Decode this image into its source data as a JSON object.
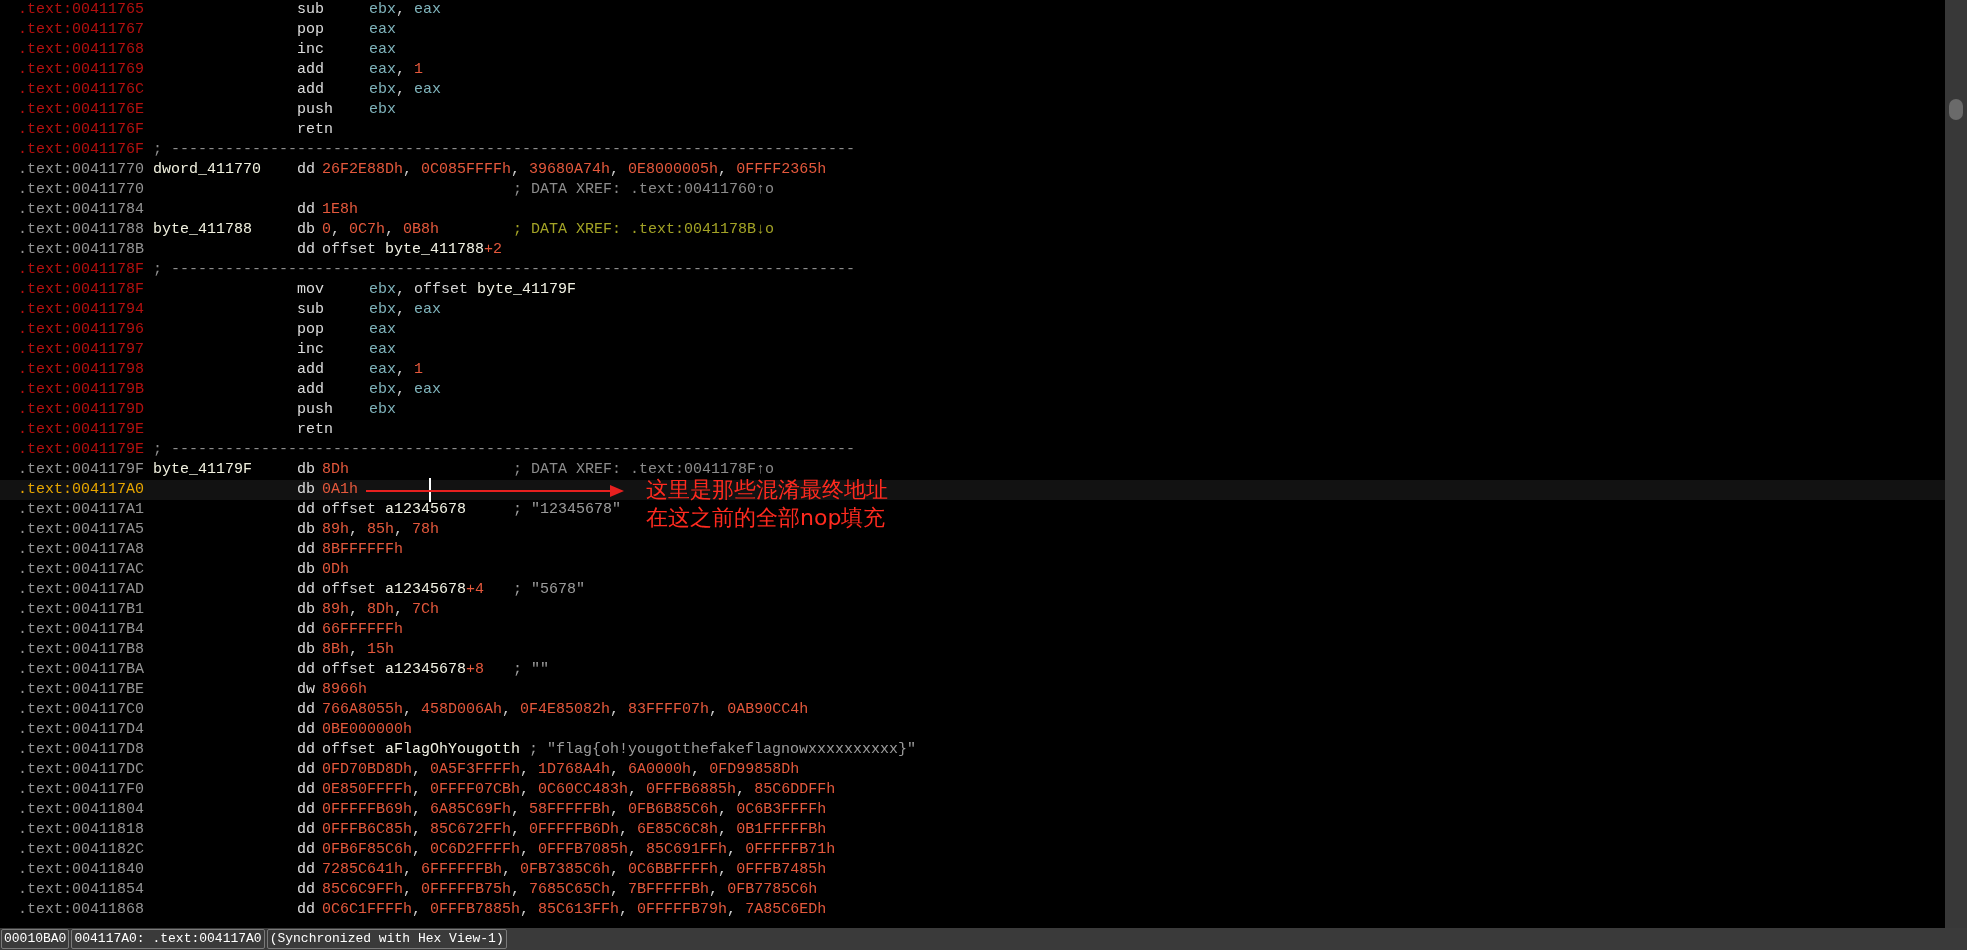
{
  "listing": {
    "rows": [
      {
        "address": ".text:00411765",
        "kind": "code",
        "selected": false,
        "mnemonic": "sub",
        "operands": [
          {
            "text": "ebx",
            "kind": "reg"
          },
          {
            "text": ", ",
            "kind": "punct"
          },
          {
            "text": "eax",
            "kind": "reg"
          }
        ]
      },
      {
        "address": ".text:00411767",
        "kind": "code",
        "selected": false,
        "mnemonic": "pop",
        "operands": [
          {
            "text": "eax",
            "kind": "reg"
          }
        ]
      },
      {
        "address": ".text:00411768",
        "kind": "code",
        "selected": false,
        "mnemonic": "inc",
        "operands": [
          {
            "text": "eax",
            "kind": "reg"
          }
        ]
      },
      {
        "address": ".text:00411769",
        "kind": "code",
        "selected": false,
        "mnemonic": "add",
        "operands": [
          {
            "text": "eax",
            "kind": "reg"
          },
          {
            "text": ", ",
            "kind": "punct"
          },
          {
            "text": "1",
            "kind": "num"
          }
        ]
      },
      {
        "address": ".text:0041176C",
        "kind": "code",
        "selected": false,
        "mnemonic": "add",
        "operands": [
          {
            "text": "ebx",
            "kind": "reg"
          },
          {
            "text": ", ",
            "kind": "punct"
          },
          {
            "text": "eax",
            "kind": "reg"
          }
        ]
      },
      {
        "address": ".text:0041176E",
        "kind": "code",
        "selected": false,
        "mnemonic": "push",
        "operands": [
          {
            "text": "ebx",
            "kind": "reg"
          }
        ]
      },
      {
        "address": ".text:0041176F",
        "kind": "code",
        "selected": false,
        "mnemonic": "retn"
      },
      {
        "address": ".text:0041176F",
        "kind": "code",
        "selected": false,
        "separator": "; ----------------------------------------------------------------------------"
      },
      {
        "address": ".text:00411770",
        "kind": "data",
        "selected": false,
        "label": "dword_411770",
        "mnemonic": "dd",
        "operands": [
          {
            "text": "26F2E88Dh",
            "kind": "num"
          },
          {
            "text": ", ",
            "kind": "punct"
          },
          {
            "text": "0C085FFFFh",
            "kind": "num"
          },
          {
            "text": ", ",
            "kind": "punct"
          },
          {
            "text": "39680A74h",
            "kind": "num"
          },
          {
            "text": ", ",
            "kind": "punct"
          },
          {
            "text": "0E8000005h",
            "kind": "num"
          },
          {
            "text": ", ",
            "kind": "punct"
          },
          {
            "text": "0FFFF2365h",
            "kind": "num"
          }
        ]
      },
      {
        "address": ".text:00411770",
        "kind": "data",
        "selected": false,
        "comment": {
          "text": "; DATA XREF: .text:00411760↑o",
          "kind": "xref"
        }
      },
      {
        "address": ".text:00411784",
        "kind": "data",
        "selected": false,
        "mnemonic": "dd",
        "operands": [
          {
            "text": "1E8h",
            "kind": "num"
          }
        ]
      },
      {
        "address": ".text:00411788",
        "kind": "data",
        "selected": false,
        "label": "byte_411788",
        "mnemonic": "db",
        "operands": [
          {
            "text": "0",
            "kind": "num"
          },
          {
            "text": ", ",
            "kind": "punct"
          },
          {
            "text": "0C7h",
            "kind": "num"
          },
          {
            "text": ", ",
            "kind": "punct"
          },
          {
            "text": "0B8h",
            "kind": "num"
          }
        ],
        "comment": {
          "text": "; DATA XREF: .text:0041178B↓o",
          "kind": "highlight"
        }
      },
      {
        "address": ".text:0041178B",
        "kind": "data",
        "selected": false,
        "mnemonic": "dd",
        "operands": [
          {
            "text": "offset ",
            "kind": "kw"
          },
          {
            "text": "byte_411788",
            "kind": "name"
          },
          {
            "text": "+2",
            "kind": "num"
          }
        ]
      },
      {
        "address": ".text:0041178F",
        "kind": "code",
        "selected": false,
        "separator": "; ----------------------------------------------------------------------------"
      },
      {
        "address": ".text:0041178F",
        "kind": "code",
        "selected": false,
        "mnemonic": "mov",
        "operands": [
          {
            "text": "ebx",
            "kind": "reg"
          },
          {
            "text": ", ",
            "kind": "punct"
          },
          {
            "text": "offset ",
            "kind": "kw"
          },
          {
            "text": "byte_41179F",
            "kind": "name"
          }
        ]
      },
      {
        "address": ".text:00411794",
        "kind": "code",
        "selected": false,
        "mnemonic": "sub",
        "operands": [
          {
            "text": "ebx",
            "kind": "reg"
          },
          {
            "text": ", ",
            "kind": "punct"
          },
          {
            "text": "eax",
            "kind": "reg"
          }
        ]
      },
      {
        "address": ".text:00411796",
        "kind": "code",
        "selected": false,
        "mnemonic": "pop",
        "operands": [
          {
            "text": "eax",
            "kind": "reg"
          }
        ]
      },
      {
        "address": ".text:00411797",
        "kind": "code",
        "selected": false,
        "mnemonic": "inc",
        "operands": [
          {
            "text": "eax",
            "kind": "reg"
          }
        ]
      },
      {
        "address": ".text:00411798",
        "kind": "code",
        "selected": false,
        "mnemonic": "add",
        "operands": [
          {
            "text": "eax",
            "kind": "reg"
          },
          {
            "text": ", ",
            "kind": "punct"
          },
          {
            "text": "1",
            "kind": "num"
          }
        ]
      },
      {
        "address": ".text:0041179B",
        "kind": "code",
        "selected": false,
        "mnemonic": "add",
        "operands": [
          {
            "text": "ebx",
            "kind": "reg"
          },
          {
            "text": ", ",
            "kind": "punct"
          },
          {
            "text": "eax",
            "kind": "reg"
          }
        ]
      },
      {
        "address": ".text:0041179D",
        "kind": "code",
        "selected": false,
        "mnemonic": "push",
        "operands": [
          {
            "text": "ebx",
            "kind": "reg"
          }
        ]
      },
      {
        "address": ".text:0041179E",
        "kind": "code",
        "selected": false,
        "mnemonic": "retn"
      },
      {
        "address": ".text:0041179E",
        "kind": "code",
        "selected": false,
        "separator": "; ----------------------------------------------------------------------------"
      },
      {
        "address": ".text:0041179F",
        "kind": "data",
        "selected": false,
        "label": "byte_41179F",
        "mnemonic": "db",
        "operands": [
          {
            "text": "8Dh",
            "kind": "num"
          }
        ],
        "comment": {
          "text": "; DATA XREF: .text:0041178F↑o",
          "kind": "xref"
        }
      },
      {
        "address": ".text:004117A0",
        "kind": "data",
        "selected": true,
        "mnemonic": "db",
        "operands": [
          {
            "text": "0A1h",
            "kind": "num"
          }
        ]
      },
      {
        "address": ".text:004117A1",
        "kind": "data",
        "selected": false,
        "mnemonic": "dd",
        "operands": [
          {
            "text": "offset ",
            "kind": "kw"
          },
          {
            "text": "a12345678",
            "kind": "name"
          }
        ],
        "comment": {
          "text": "; \"12345678\"",
          "kind": "string"
        }
      },
      {
        "address": ".text:004117A5",
        "kind": "data",
        "selected": false,
        "mnemonic": "db",
        "operands": [
          {
            "text": "89h",
            "kind": "num"
          },
          {
            "text": ", ",
            "kind": "punct"
          },
          {
            "text": "85h",
            "kind": "num"
          },
          {
            "text": ", ",
            "kind": "punct"
          },
          {
            "text": "78h",
            "kind": "num"
          }
        ]
      },
      {
        "address": ".text:004117A8",
        "kind": "data",
        "selected": false,
        "mnemonic": "dd",
        "operands": [
          {
            "text": "8BFFFFFFh",
            "kind": "num"
          }
        ]
      },
      {
        "address": ".text:004117AC",
        "kind": "data",
        "selected": false,
        "mnemonic": "db",
        "operands": [
          {
            "text": "0Dh",
            "kind": "num"
          }
        ]
      },
      {
        "address": ".text:004117AD",
        "kind": "data",
        "selected": false,
        "mnemonic": "dd",
        "operands": [
          {
            "text": "offset ",
            "kind": "kw"
          },
          {
            "text": "a12345678",
            "kind": "name"
          },
          {
            "text": "+4",
            "kind": "num"
          }
        ],
        "comment": {
          "text": "; \"5678\"",
          "kind": "string"
        }
      },
      {
        "address": ".text:004117B1",
        "kind": "data",
        "selected": false,
        "mnemonic": "db",
        "operands": [
          {
            "text": "89h",
            "kind": "num"
          },
          {
            "text": ", ",
            "kind": "punct"
          },
          {
            "text": "8Dh",
            "kind": "num"
          },
          {
            "text": ", ",
            "kind": "punct"
          },
          {
            "text": "7Ch",
            "kind": "num"
          }
        ]
      },
      {
        "address": ".text:004117B4",
        "kind": "data",
        "selected": false,
        "mnemonic": "dd",
        "operands": [
          {
            "text": "66FFFFFFh",
            "kind": "num"
          }
        ]
      },
      {
        "address": ".text:004117B8",
        "kind": "data",
        "selected": false,
        "mnemonic": "db",
        "operands": [
          {
            "text": "8Bh",
            "kind": "num"
          },
          {
            "text": ", ",
            "kind": "punct"
          },
          {
            "text": "15h",
            "kind": "num"
          }
        ]
      },
      {
        "address": ".text:004117BA",
        "kind": "data",
        "selected": false,
        "mnemonic": "dd",
        "operands": [
          {
            "text": "offset ",
            "kind": "kw"
          },
          {
            "text": "a12345678",
            "kind": "name"
          },
          {
            "text": "+8",
            "kind": "num"
          }
        ],
        "comment": {
          "text": "; \"\"",
          "kind": "string"
        }
      },
      {
        "address": ".text:004117BE",
        "kind": "data",
        "selected": false,
        "mnemonic": "dw",
        "operands": [
          {
            "text": "8966h",
            "kind": "num"
          }
        ]
      },
      {
        "address": ".text:004117C0",
        "kind": "data",
        "selected": false,
        "mnemonic": "dd",
        "operands": [
          {
            "text": "766A8055h",
            "kind": "num"
          },
          {
            "text": ", ",
            "kind": "punct"
          },
          {
            "text": "458D006Ah",
            "kind": "num"
          },
          {
            "text": ", ",
            "kind": "punct"
          },
          {
            "text": "0F4E85082h",
            "kind": "num"
          },
          {
            "text": ", ",
            "kind": "punct"
          },
          {
            "text": "83FFFF07h",
            "kind": "num"
          },
          {
            "text": ", ",
            "kind": "punct"
          },
          {
            "text": "0AB90CC4h",
            "kind": "num"
          }
        ]
      },
      {
        "address": ".text:004117D4",
        "kind": "data",
        "selected": false,
        "mnemonic": "dd",
        "operands": [
          {
            "text": "0BE000000h",
            "kind": "num"
          }
        ]
      },
      {
        "address": ".text:004117D8",
        "kind": "data",
        "selected": false,
        "mnemonic": "dd",
        "operands": [
          {
            "text": "offset ",
            "kind": "kw"
          },
          {
            "text": "aFlagOhYougotth",
            "kind": "name"
          }
        ],
        "comment": {
          "text": "; \"flag{oh!yougotthefakeflagnowxxxxxxxxxx}\"",
          "kind": "string"
        }
      },
      {
        "address": ".text:004117DC",
        "kind": "data",
        "selected": false,
        "mnemonic": "dd",
        "operands": [
          {
            "text": "0FD70BD8Dh",
            "kind": "num"
          },
          {
            "text": ", ",
            "kind": "punct"
          },
          {
            "text": "0A5F3FFFFh",
            "kind": "num"
          },
          {
            "text": ", ",
            "kind": "punct"
          },
          {
            "text": "1D768A4h",
            "kind": "num"
          },
          {
            "text": ", ",
            "kind": "punct"
          },
          {
            "text": "6A0000h",
            "kind": "num"
          },
          {
            "text": ", ",
            "kind": "punct"
          },
          {
            "text": "0FD99858Dh",
            "kind": "num"
          }
        ]
      },
      {
        "address": ".text:004117F0",
        "kind": "data",
        "selected": false,
        "mnemonic": "dd",
        "operands": [
          {
            "text": "0E850FFFFh",
            "kind": "num"
          },
          {
            "text": ", ",
            "kind": "punct"
          },
          {
            "text": "0FFFF07CBh",
            "kind": "num"
          },
          {
            "text": ", ",
            "kind": "punct"
          },
          {
            "text": "0C60CC483h",
            "kind": "num"
          },
          {
            "text": ", ",
            "kind": "punct"
          },
          {
            "text": "0FFFB6885h",
            "kind": "num"
          },
          {
            "text": ", ",
            "kind": "punct"
          },
          {
            "text": "85C6DDFFh",
            "kind": "num"
          }
        ]
      },
      {
        "address": ".text:00411804",
        "kind": "data",
        "selected": false,
        "mnemonic": "dd",
        "operands": [
          {
            "text": "0FFFFFB69h",
            "kind": "num"
          },
          {
            "text": ", ",
            "kind": "punct"
          },
          {
            "text": "6A85C69Fh",
            "kind": "num"
          },
          {
            "text": ", ",
            "kind": "punct"
          },
          {
            "text": "58FFFFFBh",
            "kind": "num"
          },
          {
            "text": ", ",
            "kind": "punct"
          },
          {
            "text": "0FB6B85C6h",
            "kind": "num"
          },
          {
            "text": ", ",
            "kind": "punct"
          },
          {
            "text": "0C6B3FFFFh",
            "kind": "num"
          }
        ]
      },
      {
        "address": ".text:00411818",
        "kind": "data",
        "selected": false,
        "mnemonic": "dd",
        "operands": [
          {
            "text": "0FFFB6C85h",
            "kind": "num"
          },
          {
            "text": ", ",
            "kind": "punct"
          },
          {
            "text": "85C672FFh",
            "kind": "num"
          },
          {
            "text": ", ",
            "kind": "punct"
          },
          {
            "text": "0FFFFFB6Dh",
            "kind": "num"
          },
          {
            "text": ", ",
            "kind": "punct"
          },
          {
            "text": "6E85C6C8h",
            "kind": "num"
          },
          {
            "text": ", ",
            "kind": "punct"
          },
          {
            "text": "0B1FFFFFBh",
            "kind": "num"
          }
        ]
      },
      {
        "address": ".text:0041182C",
        "kind": "data",
        "selected": false,
        "mnemonic": "dd",
        "operands": [
          {
            "text": "0FB6F85C6h",
            "kind": "num"
          },
          {
            "text": ", ",
            "kind": "punct"
          },
          {
            "text": "0C6D2FFFFh",
            "kind": "num"
          },
          {
            "text": ", ",
            "kind": "punct"
          },
          {
            "text": "0FFFB7085h",
            "kind": "num"
          },
          {
            "text": ", ",
            "kind": "punct"
          },
          {
            "text": "85C691FFh",
            "kind": "num"
          },
          {
            "text": ", ",
            "kind": "punct"
          },
          {
            "text": "0FFFFFB71h",
            "kind": "num"
          }
        ]
      },
      {
        "address": ".text:00411840",
        "kind": "data",
        "selected": false,
        "mnemonic": "dd",
        "operands": [
          {
            "text": "7285C641h",
            "kind": "num"
          },
          {
            "text": ", ",
            "kind": "punct"
          },
          {
            "text": "6FFFFFFBh",
            "kind": "num"
          },
          {
            "text": ", ",
            "kind": "punct"
          },
          {
            "text": "0FB7385C6h",
            "kind": "num"
          },
          {
            "text": ", ",
            "kind": "punct"
          },
          {
            "text": "0C6BBFFFFh",
            "kind": "num"
          },
          {
            "text": ", ",
            "kind": "punct"
          },
          {
            "text": "0FFFB7485h",
            "kind": "num"
          }
        ]
      },
      {
        "address": ".text:00411854",
        "kind": "data",
        "selected": false,
        "mnemonic": "dd",
        "operands": [
          {
            "text": "85C6C9FFh",
            "kind": "num"
          },
          {
            "text": ", ",
            "kind": "punct"
          },
          {
            "text": "0FFFFFB75h",
            "kind": "num"
          },
          {
            "text": ", ",
            "kind": "punct"
          },
          {
            "text": "7685C65Ch",
            "kind": "num"
          },
          {
            "text": ", ",
            "kind": "punct"
          },
          {
            "text": "7BFFFFFBh",
            "kind": "num"
          },
          {
            "text": ", ",
            "kind": "punct"
          },
          {
            "text": "0FB7785C6h",
            "kind": "num"
          }
        ]
      },
      {
        "address": ".text:00411868",
        "kind": "data",
        "selected": false,
        "mnemonic": "dd",
        "operands": [
          {
            "text": "0C6C1FFFFh",
            "kind": "num"
          },
          {
            "text": ", ",
            "kind": "punct"
          },
          {
            "text": "0FFFB7885h",
            "kind": "num"
          },
          {
            "text": ", ",
            "kind": "punct"
          },
          {
            "text": "85C613FFh",
            "kind": "num"
          },
          {
            "text": ", ",
            "kind": "punct"
          },
          {
            "text": "0FFFFFB79h",
            "kind": "num"
          },
          {
            "text": ", ",
            "kind": "punct"
          },
          {
            "text": "7A85C6EDh",
            "kind": "num"
          }
        ]
      }
    ]
  },
  "annotation": {
    "lines": [
      "这里是那些混淆最终地址",
      "在这之前的全部nop填充"
    ]
  },
  "status_bar": {
    "fields": [
      "00010BA0",
      "004117A0: .text:004117A0",
      "(Synchronized with Hex View-1)"
    ]
  }
}
